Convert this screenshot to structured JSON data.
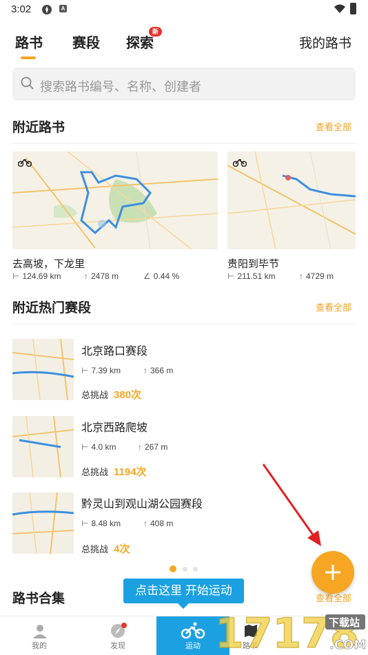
{
  "status_bar": {
    "time": "3:02",
    "app_icon_letter": "A"
  },
  "tabs": [
    {
      "label": "路书"
    },
    {
      "label": "赛段"
    },
    {
      "label": "探索",
      "badge": "新"
    }
  ],
  "my_routes_label": "我的路书",
  "search": {
    "placeholder": "搜索路书编号、名称、创建者"
  },
  "nearby_routes": {
    "title": "附近路书",
    "more_label": "查看全部",
    "cards": [
      {
        "name": "去高坡，下龙里",
        "distance": "124.69 km",
        "climb": "2478 m",
        "grade": "0.44 %"
      },
      {
        "name": "贵阳到毕节",
        "distance": "211.51 km",
        "climb": "4729 m"
      }
    ]
  },
  "hot_segments": {
    "title": "附近热门赛段",
    "more_label": "查看全部",
    "items": [
      {
        "name": "北京路口赛段",
        "distance": "7.39 km",
        "climb": "366 m",
        "challenge_label": "总挑战",
        "challenge_count": "380次"
      },
      {
        "name": "北京西路爬坡",
        "distance": "4.0 km",
        "climb": "267 m",
        "challenge_label": "总挑战",
        "challenge_count": "1194次"
      },
      {
        "name": "黔灵山到观山湖公园赛段",
        "distance": "8.48 km",
        "climb": "408 m",
        "challenge_label": "总挑战",
        "challenge_count": "4次"
      }
    ]
  },
  "collections": {
    "title": "路书合集",
    "more_label": "查看全部"
  },
  "tooltip": "点击这里 开始运动",
  "bottom_nav": [
    {
      "label": "我的"
    },
    {
      "label": "发现"
    },
    {
      "label": "运动"
    },
    {
      "label": "路书"
    },
    {
      "label": ""
    }
  ],
  "watermark": {
    "brand": "17178",
    "domain": ".COM",
    "tag": "下载站"
  },
  "colors": {
    "accent": "#f6a623",
    "blue": "#1ba1e2",
    "badge_red": "#e8332a",
    "annotation_arrow": "#e02020"
  }
}
